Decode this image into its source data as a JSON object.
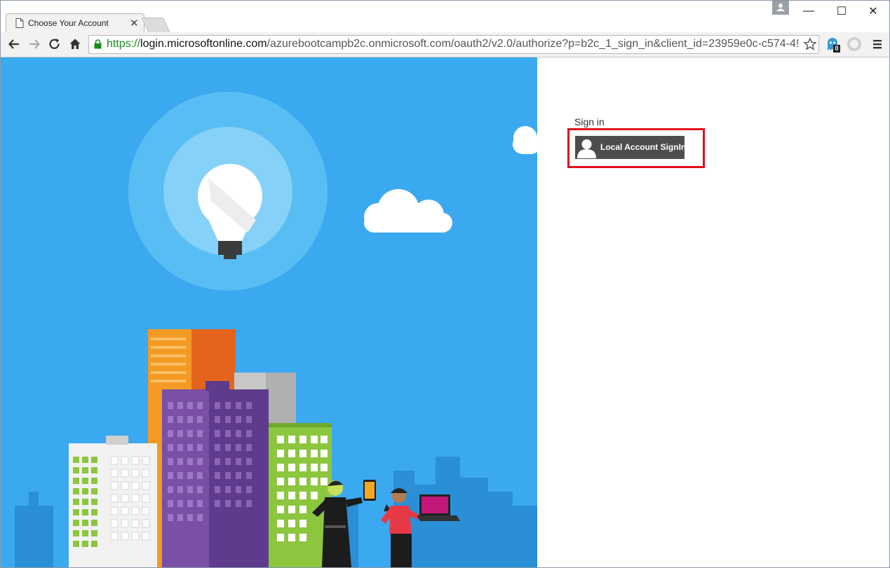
{
  "browser": {
    "tab_title": "Choose Your Account",
    "url_scheme": "https://",
    "url_host": "login.microsoftonline.com",
    "url_path": "/azurebootcampb2c.onmicrosoft.com/oauth2/v2.0/authorize?p=b2c_1_sign_in&client_id=23959e0c-c574-4!",
    "extension_badge": "0",
    "window_controls": {
      "minimize": "—",
      "maximize": "☐",
      "close": "✕"
    }
  },
  "icons": [
    "page-icon",
    "close-icon",
    "back-icon",
    "forward-icon",
    "reload-icon",
    "home-icon",
    "lock-icon",
    "star-icon",
    "ghostery-icon",
    "opera-icon",
    "menu-icon",
    "user-icon",
    "lightbulb-icon"
  ],
  "colors": {
    "hero_background": "#3ba9ef",
    "button_background": "#4d4d4d",
    "highlight_border": "#e0101c",
    "url_secure": "#1a8a1a"
  },
  "signin": {
    "heading": "Sign in",
    "local_account_button": "Local Account SignIn"
  }
}
